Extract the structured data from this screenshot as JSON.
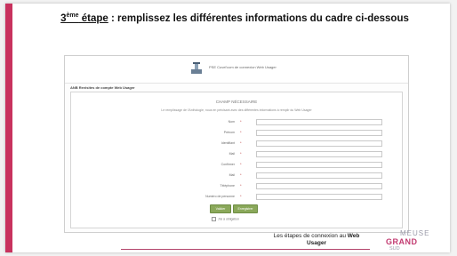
{
  "slide": {
    "title_prefix": "3",
    "title_sup": "ème",
    "title_step": " étape",
    "title_rest": " : remplissez les différentes informations du cadre ci-dessous"
  },
  "shot": {
    "header_text": "PSE Cuvel'com de connexion Web Usager",
    "panel_title": "ANB Revisites de compte Web Usager",
    "form_heading": "CHAMP NÉCESSAIRE",
    "form_desc": "Le remplissage de l'Anthologie, nous en précisant avec des différentes informations à remplir du Web Usager",
    "fields": [
      {
        "label": "Nom"
      },
      {
        "label": "Prénom"
      },
      {
        "label": "Identifiant"
      },
      {
        "label": "Mail"
      },
      {
        "label": "Confirmer"
      },
      {
        "label": "Mail"
      },
      {
        "label": "Téléphone"
      },
      {
        "label": "Numéro de personne"
      }
    ],
    "btn_primary": "Valider",
    "btn_secondary": "Enregistrer",
    "cgu_text": "J'ai à obligation"
  },
  "footer": {
    "line1": "Les étapes de connexion au ",
    "bold1": "Web",
    "bold2": "Usager"
  },
  "brand": {
    "line1": "MEUSE",
    "line2": "GRAND",
    "line3": "SUD"
  },
  "colors": {
    "accent": "#c8325e",
    "button_green": "#8aa85a"
  }
}
